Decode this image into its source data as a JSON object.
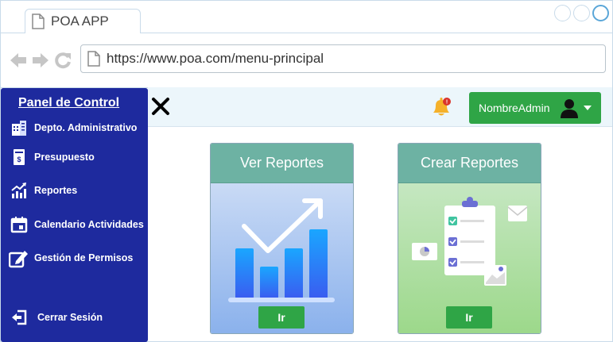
{
  "browser": {
    "tab_title": "POA APP",
    "url": "https://www.poa.com/menu-principal"
  },
  "topbar": {
    "user_name": "NombreAdmin",
    "notification_count": "!"
  },
  "sidebar": {
    "title": "Panel de Control",
    "items": [
      {
        "label": "Depto. Administrativo",
        "icon": "building-icon"
      },
      {
        "label": "Presupuesto",
        "icon": "budget-icon"
      },
      {
        "label": "Reportes",
        "icon": "chart-icon"
      },
      {
        "label": "Calendario Actividades",
        "icon": "calendar-icon"
      },
      {
        "label": "Gestión de Permisos",
        "icon": "edit-icon"
      }
    ],
    "logout_label": "Cerrar Sesión"
  },
  "cards": [
    {
      "title": "Ver Reportes",
      "button": "Ir"
    },
    {
      "title": "Crear Reportes",
      "button": "Ir"
    }
  ],
  "colors": {
    "sidebar": "#1e2a9e",
    "accent_green": "#2fa546",
    "card_header": "#6db2a3"
  }
}
